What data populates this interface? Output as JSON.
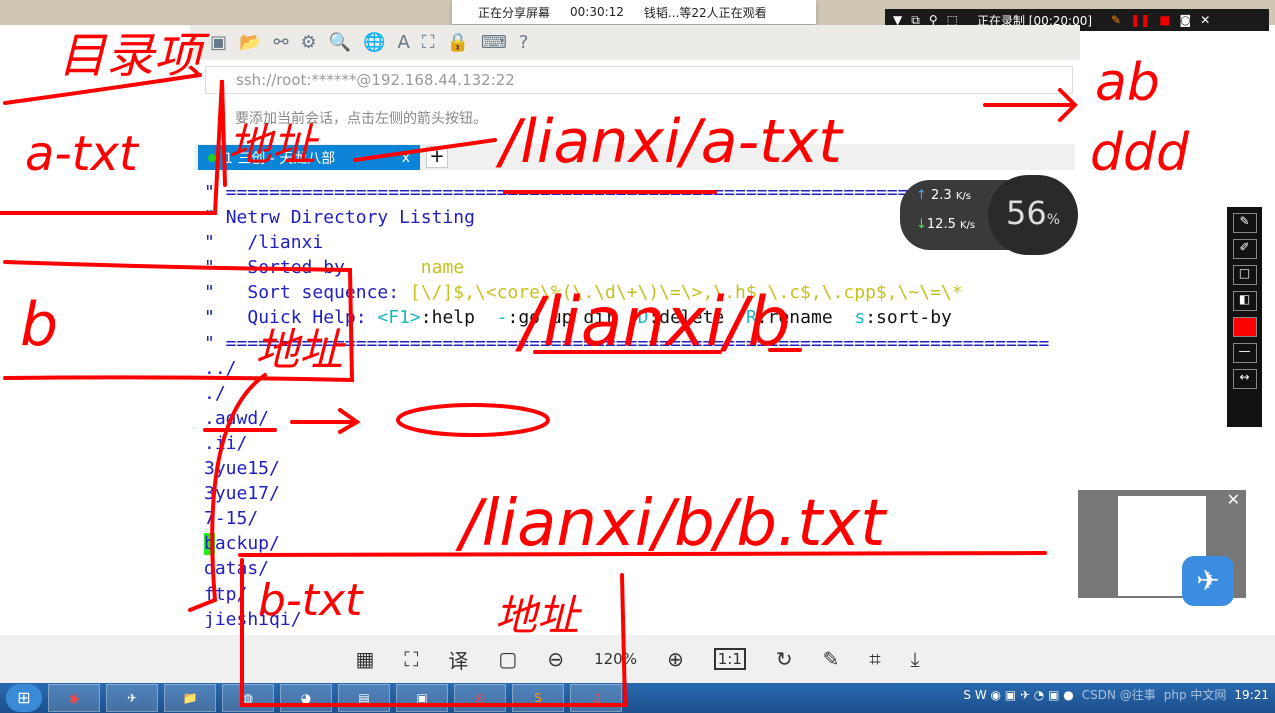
{
  "share_bar": {
    "status": "正在分享屏幕",
    "time": "00:30:12",
    "viewers": "钱韬...等22人正在观看"
  },
  "recorder": {
    "status": "正在录制 [00:20:00]"
  },
  "address_bar": {
    "value": "ssh://root:******@192.168.44.132:22"
  },
  "hint": "要添加当前会话，点击左侧的箭头按钮。",
  "tab": {
    "label": "1 三创 - 天龙八部",
    "close": "x",
    "add": "+"
  },
  "terminal": {
    "header": {
      "rule": "\" ============================================================================",
      "title": "Netrw Directory Listing",
      "path": "/lianxi",
      "sorted_by_label": "Sorted by",
      "sorted_by_value": "name",
      "sort_seq_label": "Sort sequence:",
      "sort_seq_value": "[\\/]$,\\<core\\%(\\.\\d\\+\\)\\=\\>,\\.h$,\\.c$,\\.cpp$,\\~\\=\\*",
      "quick_help": "Quick Help:",
      "help_items": [
        [
          "<F1>",
          ":help"
        ],
        [
          "-",
          ":go up dir"
        ],
        [
          "D",
          ":delete"
        ],
        [
          "R",
          ":rename"
        ],
        [
          "s",
          ":sort-by"
        ]
      ]
    },
    "entries": [
      "../",
      "./",
      ".adwd/",
      ".ii/",
      "3yue15/",
      "3yue17/",
      "7-15/",
      "backup/",
      "datas/",
      "ftp/",
      "jieshiqi/"
    ],
    "cursor_entry": "backup/"
  },
  "network": {
    "up": "2.3",
    "down": "12.5",
    "unit": "K/s",
    "cpu": "56",
    "cpu_unit": "%"
  },
  "viewer": {
    "zoom": "120%",
    "one_to_one": "1:1"
  },
  "annotations": [
    "目录项",
    "a-txt",
    "地址",
    "/lianxi/a-txt",
    "ab",
    "ddd",
    "b",
    "地址",
    "/lianxi/b",
    "/lianxi/b/b.txt",
    "b-txt",
    "地址"
  ],
  "tray": {
    "clock": "19:21",
    "watermark": "php 中文网",
    "csdn": "CSDN @往事"
  },
  "colors": {
    "annotation": "#ff0000",
    "tab_active": "#0a84d6",
    "netrw_blue": "#2020c0",
    "netrw_yellow": "#c8c020",
    "netrw_cyan": "#20b8c0",
    "cursor": "#22ee22"
  }
}
